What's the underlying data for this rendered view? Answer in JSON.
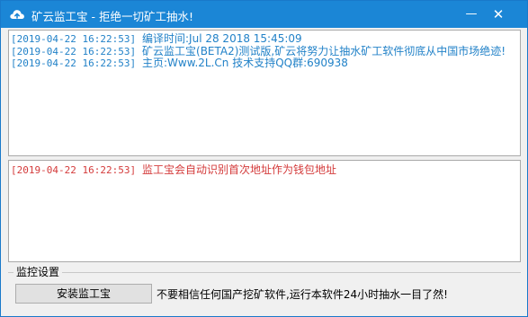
{
  "window": {
    "title": "矿云监工宝 - 拒绝一切矿工抽水!",
    "minimize_glyph": "—",
    "close_glyph": "✕",
    "icon": "cloud-upload-icon",
    "colors": {
      "titlebar": "#1b86d6",
      "log_blue": "#2282c8",
      "log_red": "#d43b3b"
    }
  },
  "log_top": {
    "lines": [
      {
        "timestamp": "[2019-04-22 16:22:53]",
        "message": "编译时间:Jul 28 2018 15:45:09"
      },
      {
        "timestamp": "[2019-04-22 16:22:53]",
        "message": "矿云监工宝(BETA2)测试版,矿云将努力让抽水矿工软件彻底从中国市场绝迹!"
      },
      {
        "timestamp": "[2019-04-22 16:22:53]",
        "message": "主页:Www.2L.Cn 技术支持QQ群:690938"
      }
    ]
  },
  "log_bottom": {
    "lines": [
      {
        "timestamp": "[2019-04-22 16:22:53]",
        "message": "监工宝会自动识别首次地址作为钱包地址"
      }
    ]
  },
  "monitor_settings": {
    "group_title": "监控设置",
    "install_button": "安装监工宝",
    "note": "不要相信任何国产挖矿软件,运行本软件24小时抽水一目了然!"
  }
}
